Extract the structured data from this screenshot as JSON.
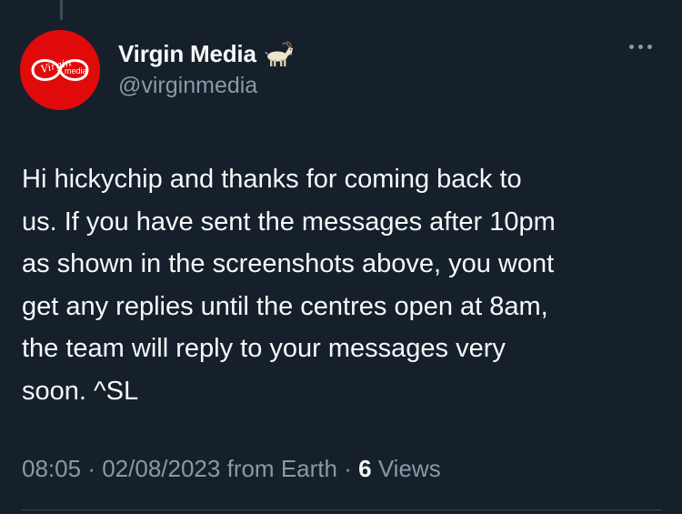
{
  "tweet": {
    "author": {
      "display_name": "Virgin Media",
      "name_emoji": "goat-emoji",
      "handle": "@virginmedia",
      "avatar_brand_script": "Virgin",
      "avatar_brand_word": "media",
      "avatar_color": "#e10a0a"
    },
    "text": "Hi hickychip and thanks for coming back to\nus. If you have sent the messages after 10pm\nas shown in the screenshots above, you wont\nget any replies until the centres open at 8am,\nthe team will reply to your messages very\nsoon. ^SL",
    "time": "08:05",
    "separator": "·",
    "date": "02/08/2023",
    "location": "from Earth",
    "views_count": "6",
    "views_label": "Views"
  },
  "more_icon": "more-horizontal-icon",
  "colors": {
    "background": "#15202b",
    "text_primary": "#f7f9f9",
    "text_secondary": "#8b98a5",
    "divider": "#38444d"
  }
}
